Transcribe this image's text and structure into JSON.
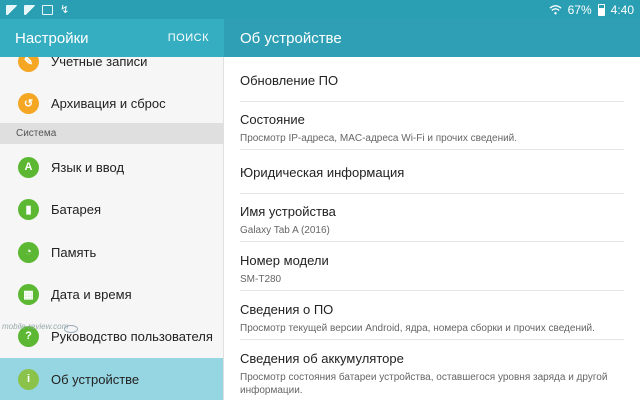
{
  "status_bar": {
    "notifications": [
      "image-icon",
      "gallery-icon",
      "mail-icon",
      "usb-icon"
    ],
    "battery_percent": "67%",
    "time": "4:40"
  },
  "left_header": {
    "title": "Настройки",
    "search": "ПОИСК"
  },
  "right_header": {
    "title": "Об устройстве"
  },
  "sidebar": {
    "partial_item": "Учетные записи",
    "backup_item": "Архивация и сброс",
    "section_system": "Система",
    "items": [
      {
        "label": "Язык и ввод",
        "icon": "keyboard-icon"
      },
      {
        "label": "Батарея",
        "icon": "battery-icon"
      },
      {
        "label": "Память",
        "icon": "storage-icon"
      },
      {
        "label": "Дата и время",
        "icon": "calendar-icon"
      },
      {
        "label": "Руководство пользователя",
        "icon": "help-icon"
      },
      {
        "label": "Об устройстве",
        "icon": "info-icon",
        "selected": true
      }
    ]
  },
  "watermark": "mobile-review.com",
  "details": [
    {
      "title": "Обновление ПО",
      "subtitle": ""
    },
    {
      "title": "Состояние",
      "subtitle": "Просмотр IP-адреса, MAC-адреса Wi-Fi и прочих сведений."
    },
    {
      "title": "Юридическая информация",
      "subtitle": ""
    },
    {
      "title": "Имя устройства",
      "subtitle": "Galaxy Tab A (2016)"
    },
    {
      "title": "Номер модели",
      "subtitle": "SM-T280"
    },
    {
      "title": "Сведения о ПО",
      "subtitle": "Просмотр текущей версии Android, ядра, номера сборки и прочих сведений."
    },
    {
      "title": "Сведения об аккумуляторе",
      "subtitle": "Просмотр состояния батареи устройства, оставшегося уровня заряда и другой информации."
    }
  ]
}
